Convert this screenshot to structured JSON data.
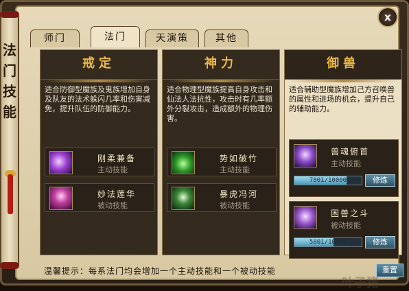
{
  "side_title": [
    "法",
    "门",
    "技",
    "能"
  ],
  "tabs": [
    {
      "label": "师门",
      "active": false
    },
    {
      "label": "法门",
      "active": true
    },
    {
      "label": "天演策",
      "active": false
    },
    {
      "label": "其他",
      "active": false
    }
  ],
  "close_label": "x",
  "panels": [
    {
      "title": "戒定",
      "description": "适合防御型魔族及鬼族增加自身及队友的法术躲闪几率和伤害减免，提升队伍的防御能力。",
      "skills": [
        {
          "name": "刚柔兼备",
          "type": "主动技能",
          "icon": "yin-yang-icon"
        },
        {
          "name": "妙法莲华",
          "type": "被动技能",
          "icon": "lotus-icon"
        }
      ]
    },
    {
      "title": "神力",
      "description": "适合物理型魔族提高自身攻击和仙法人法抗性，攻击时有几率额外分裂攻击，造成额外的物理伤害。",
      "skills": [
        {
          "name": "势如破竹",
          "type": "主动技能",
          "icon": "green-vortex-icon"
        },
        {
          "name": "暴虎冯河",
          "type": "被动技能",
          "icon": "tiger-icon"
        }
      ]
    },
    {
      "title": "御兽",
      "description": "适合辅助型魔族增加己方召唤兽的属性和进场的机会，提升自己的辅助能力。",
      "skills": [
        {
          "name": "兽魂俯首",
          "type": "主动技能",
          "icon": "beast-soul-icon",
          "progress_text": "7801/10000",
          "progress": 0.7801,
          "button": "修炼"
        },
        {
          "name": "困兽之斗",
          "type": "被动技能",
          "icon": "beast-fight-icon",
          "progress_text": "5801/10000",
          "progress": 0.5801,
          "button": "修炼"
        }
      ]
    }
  ],
  "tip": "温馨提示：每系法门均会增加一个主动技能和一个被动技能",
  "confirm_label": "重置",
  "watermark": "叶子猪"
}
